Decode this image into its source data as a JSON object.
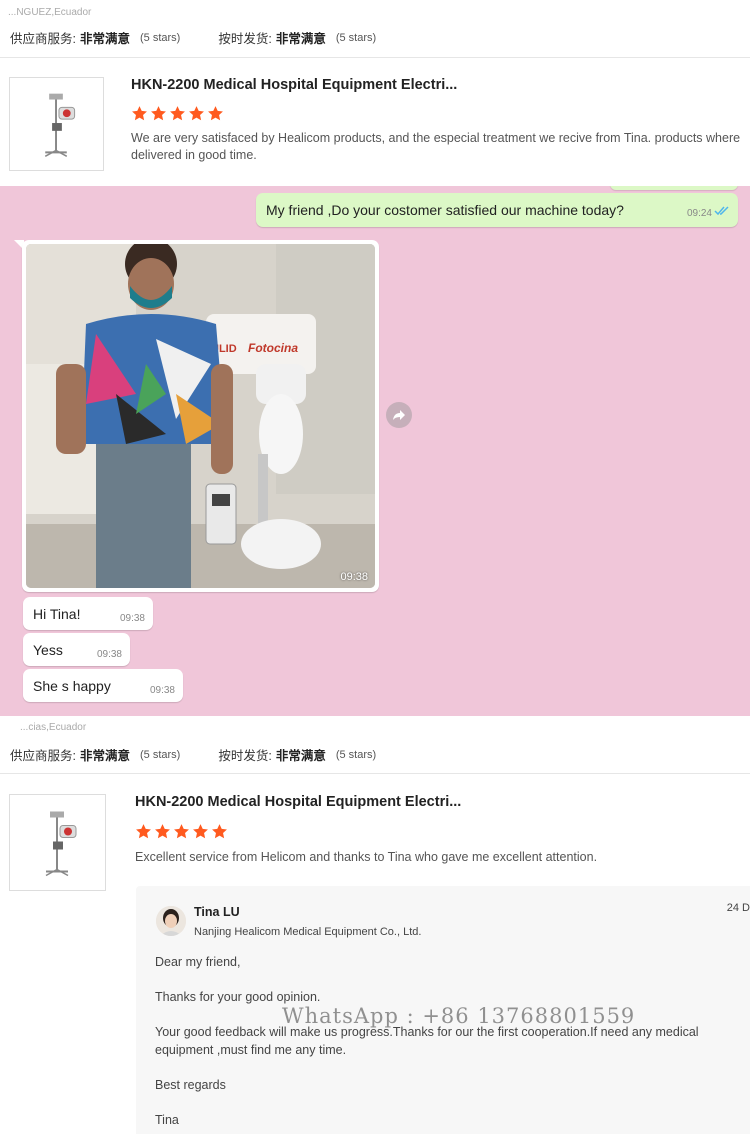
{
  "review1": {
    "reviewer_location": "...NGUEZ,Ecuador",
    "ratings": [
      {
        "label": "供应商服务:",
        "value": "非常满意",
        "stars": "(5 stars)"
      },
      {
        "label": "按时发货:",
        "value": "非常满意",
        "stars": "(5 stars)"
      }
    ],
    "product_title": "HKN-2200 Medical Hospital Equipment Electri...",
    "star_rating": 5,
    "review_text": "We are very satisfaced by Healicom products, and the especial treatment we recive from Tina. products where delivered in good time."
  },
  "chat": {
    "outgoing": {
      "text": "My friend ,Do your costomer satisfied our machine today?",
      "time": "09:24"
    },
    "photo": {
      "time": "09:38",
      "caption_tags": [
        "ULID",
        "Fotocina"
      ]
    },
    "incoming": [
      {
        "text": "Hi Tina!",
        "time": "09:38"
      },
      {
        "text": "Yess",
        "time": "09:38"
      },
      {
        "text": "She s happy",
        "time": "09:38"
      }
    ]
  },
  "review2": {
    "reviewer_location": "...cias,Ecuador",
    "ratings": [
      {
        "label": "供应商服务:",
        "value": "非常满意",
        "stars": "(5 stars)"
      },
      {
        "label": "按时发货:",
        "value": "非常满意",
        "stars": "(5 stars)"
      }
    ],
    "product_title": "HKN-2200 Medical Hospital Equipment Electri...",
    "star_rating": 5,
    "review_text": "Excellent service from Helicom and thanks to Tina who gave me excellent attention.",
    "reply": {
      "name": "Tina LU",
      "company": "Nanjing Healicom Medical Equipment Co., Ltd.",
      "date": "24 D",
      "greeting": "Dear my friend,",
      "line1": "Thanks for your good opinion.",
      "line2": "Your good feedback will make us progress.Thanks for our the first cooperation.If need any medical equipment ,must find me any time.",
      "closing": "Best regards",
      "signature": "Tina"
    },
    "watermark": "WhatsApp : +86 13768801559"
  },
  "colors": {
    "star": "#ff5a1f",
    "chat_bg": "#f0c6d9",
    "bubble_out": "#dcf8c6",
    "tick": "#4fb6ec"
  }
}
